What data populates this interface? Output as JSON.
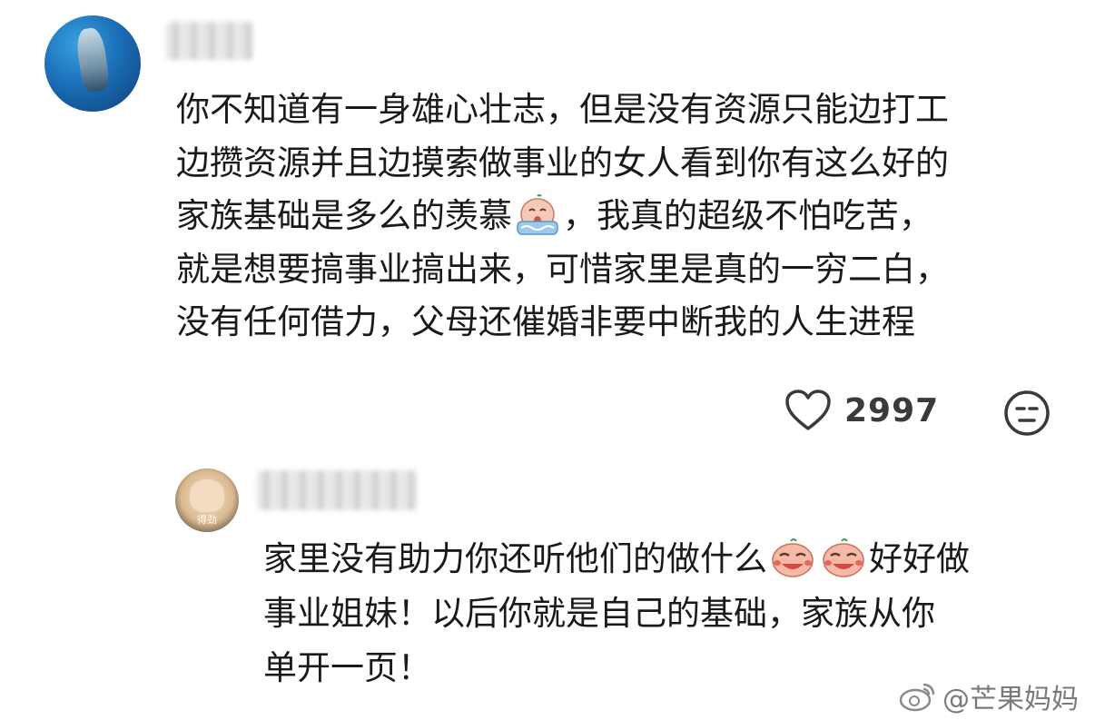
{
  "main_comment": {
    "author_avatar": "avatar-shark",
    "author_name_blurred": true,
    "text_lines": [
      "你不知道有一身雄心壮志，但是没有资源只能边打工",
      "边攒资源并且边摸索做事业的女人看到你有这么好的",
      "家族基础是多么的羡慕",
      "，我真的超级不怕吃苦，",
      "就是想要搞事业搞出来，可惜家里是真的一穷二白，",
      "没有任何借力，父母还催婚非要中断我的人生进程"
    ],
    "emoji": "crying-emoji",
    "likes": "2997",
    "like_icon": "heart-icon",
    "reaction_icon": "face-emoji-icon"
  },
  "reply_comment": {
    "author_avatar": "avatar-cat",
    "avatar_caption": "得劲",
    "author_name_blurred": true,
    "text_lines": [
      "家里没有助力你还听他们的做什么",
      "好好做",
      "事业姐妹！以后你就是自己的基础，家族从你",
      "单开一页！"
    ],
    "emoji": "laughing-emoji"
  },
  "watermark": {
    "icon": "weibo-logo-icon",
    "text": "@芒果妈妈"
  },
  "colors": {
    "text": "#1a1a1a",
    "icon": "#3a3a3a",
    "watermark": "#7a7a7a",
    "emoji_face": "#f6b9a8",
    "emoji_cheek": "#e8655a"
  }
}
